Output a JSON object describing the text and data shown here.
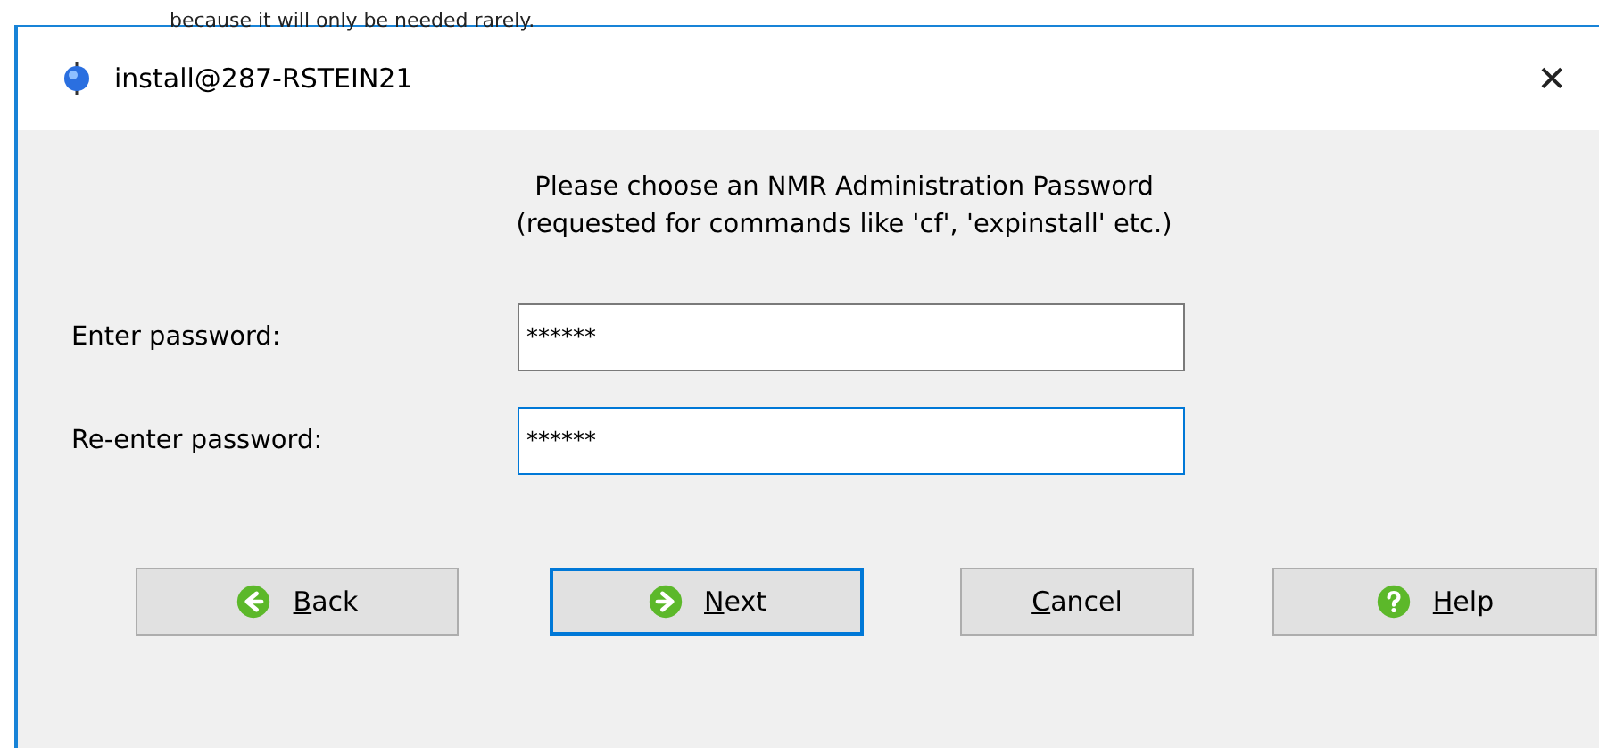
{
  "background_text": "because it will only be needed rarely.",
  "window": {
    "title": "install@287-RSTEIN21",
    "close": "✕"
  },
  "heading": [
    "Please choose an NMR Administration Password",
    "(requested for commands like 'cf', 'expinstall' etc.)"
  ],
  "fields": [
    {
      "label": "Enter password:",
      "value": "******",
      "focused": false
    },
    {
      "label": "Re-enter password:",
      "value": "******",
      "focused": true
    }
  ],
  "buttons": [
    {
      "label": "Back",
      "kind": "back",
      "mnemonic": true,
      "default": false
    },
    {
      "label": "Next",
      "kind": "next",
      "mnemonic": true,
      "default": true
    },
    {
      "label": "Cancel",
      "kind": "plain",
      "mnemonic": true,
      "default": false
    },
    {
      "label": "Help",
      "kind": "help",
      "mnemonic": true,
      "default": false
    }
  ]
}
